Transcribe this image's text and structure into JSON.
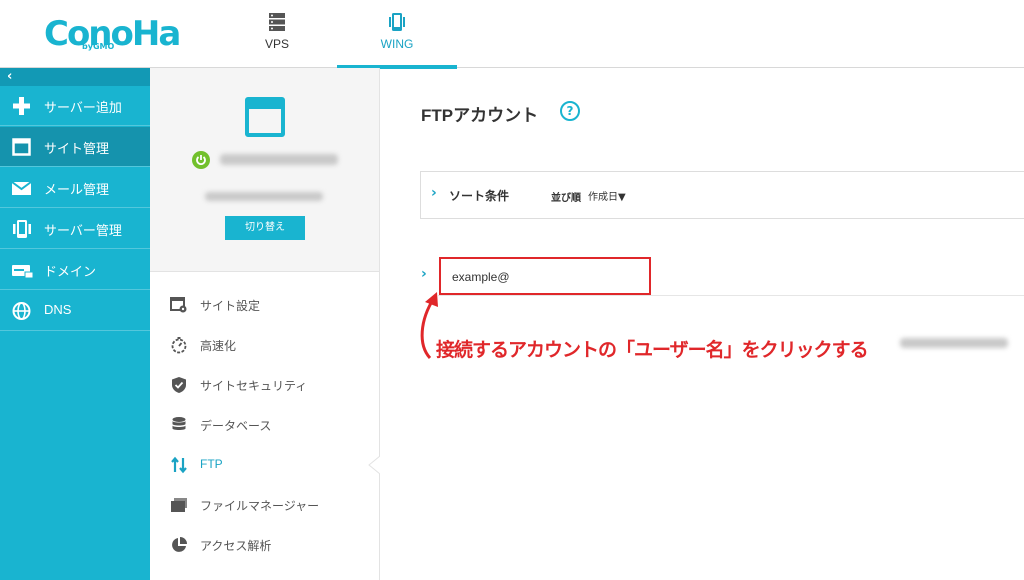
{
  "header": {
    "logo_text": "ConoHa",
    "logo_sub": "byGMO",
    "tabs": [
      {
        "label": "VPS",
        "icon": "server-icon",
        "active": false
      },
      {
        "label": "WING",
        "icon": "phone-icon",
        "active": true
      }
    ]
  },
  "sidebar": {
    "collapse_glyph": "‹",
    "items": [
      {
        "label": "サーバー追加",
        "icon": "plus-icon"
      },
      {
        "label": "サイト管理",
        "icon": "window-icon",
        "active": true
      },
      {
        "label": "メール管理",
        "icon": "mail-icon"
      },
      {
        "label": "サーバー管理",
        "icon": "server-icon"
      },
      {
        "label": "ドメイン",
        "icon": "domain-icon"
      },
      {
        "label": "DNS",
        "icon": "globe-icon"
      }
    ]
  },
  "site_panel": {
    "switch_label": "切り替え",
    "menu": [
      {
        "label": "サイト設定",
        "icon": "site-settings-icon"
      },
      {
        "label": "高速化",
        "icon": "stopwatch-icon"
      },
      {
        "label": "サイトセキュリティ",
        "icon": "shield-icon"
      },
      {
        "label": "データベース",
        "icon": "database-icon"
      },
      {
        "label": "FTP",
        "icon": "transfer-icon",
        "active": true
      },
      {
        "label": "ファイルマネージャー",
        "icon": "folder-icon"
      },
      {
        "label": "アクセス解析",
        "icon": "pie-chart-icon"
      }
    ]
  },
  "main": {
    "title": "FTPアカウント",
    "help_glyph": "?",
    "sort": {
      "label": "ソート条件",
      "order_label": "並び順",
      "order_value": "作成日▼"
    },
    "account": {
      "name_prefix": "example@"
    },
    "annotation": "接続するアカウントの「ユーザー名」をクリックする"
  },
  "colors": {
    "accent": "#19b4d0",
    "sidebar_active": "#1593ad",
    "annotation_red": "#e0272a",
    "power_green": "#72c02c"
  }
}
